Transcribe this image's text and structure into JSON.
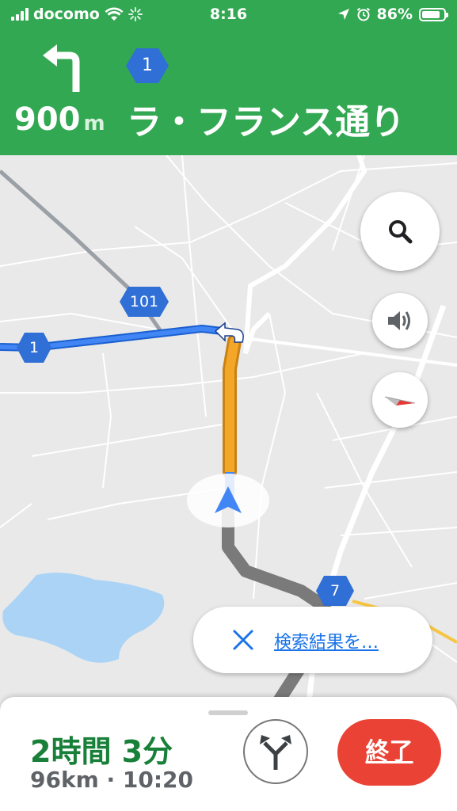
{
  "status_bar": {
    "carrier": "docomo",
    "time": "8:16",
    "battery": "86%",
    "battery_level": 0.86
  },
  "navigation": {
    "turn_icon": "turn-left-arrow",
    "distance_value": "900",
    "distance_unit": "m",
    "route_number": "1",
    "street_name": "ラ・フランス通り"
  },
  "map": {
    "route_shields": [
      {
        "id": "101",
        "label": "101"
      },
      {
        "id": "1",
        "label": "1"
      },
      {
        "id": "7",
        "label": "7"
      }
    ],
    "controls": {
      "search_icon": "search-icon",
      "sound_icon": "speaker-icon",
      "compass_icon": "compass-icon"
    },
    "search_pill": {
      "close_icon": "close-icon",
      "label": "検索結果を…"
    }
  },
  "bottom_sheet": {
    "eta_duration": "2時間 3分",
    "eta_details": "96km · 10:20",
    "alternate_routes_icon": "fork-icon",
    "end_button": "終了"
  },
  "colors": {
    "header_green": "#33a852",
    "route_blue": "#4285f4",
    "traffic_orange": "#f4a629",
    "end_red": "#ea4335",
    "eta_green": "#188038"
  }
}
